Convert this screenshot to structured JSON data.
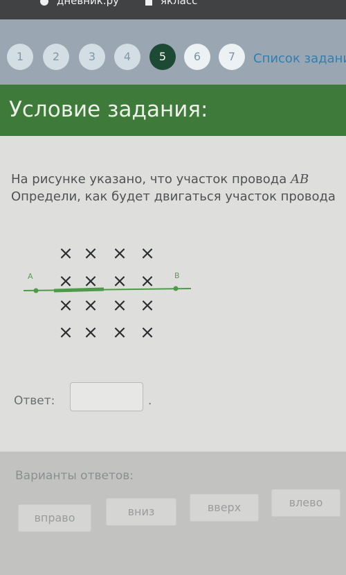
{
  "browser_bar": {
    "bookmark_1": "дневник.ру",
    "bookmark_2": "якласс"
  },
  "steps": {
    "items": [
      "1",
      "2",
      "3",
      "4",
      "5",
      "6",
      "7"
    ],
    "active": "5",
    "task_list_link": "Список заданий"
  },
  "header": {
    "title": "Условие задания:"
  },
  "task": {
    "line1_prefix": "На рисунке указано, что участок провода ",
    "line1_var": "AB",
    "line2": "Определи, как будет двигаться участок провода"
  },
  "figure": {
    "cross_symbol": "×",
    "point_a": "A",
    "point_b": "B",
    "colors": {
      "wire": "#4e9a4a",
      "cross": "#2b2d30"
    }
  },
  "answer": {
    "label": "Ответ:",
    "value": "",
    "suffix": "."
  },
  "variants": {
    "label": "Варианты ответов:",
    "options": [
      "вправо",
      "вниз",
      "вверх",
      "влево"
    ]
  }
}
